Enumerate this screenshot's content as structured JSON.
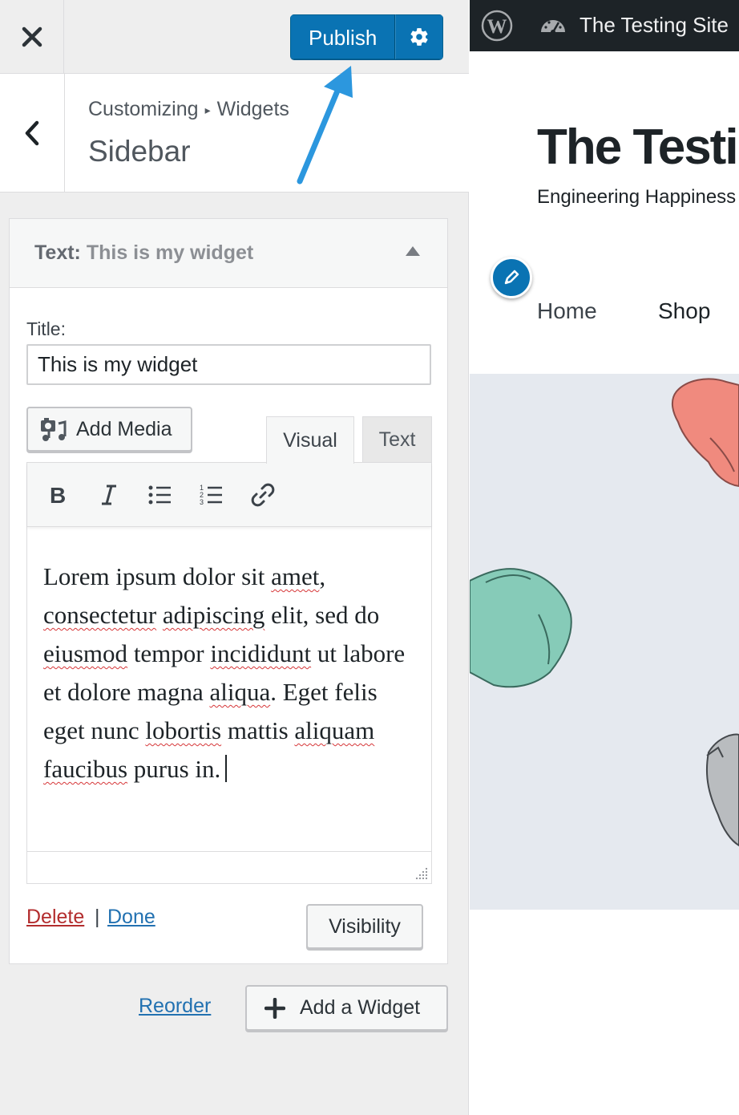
{
  "customizer": {
    "publish_label": "Publish",
    "breadcrumb_root": "Customizing",
    "breadcrumb_sep": "▸",
    "breadcrumb_current": "Widgets",
    "section_title": "Sidebar"
  },
  "widget": {
    "header_type": "Text:",
    "header_name": "This is my widget",
    "title_label": "Title:",
    "title_value": "This is my widget",
    "add_media_label": "Add Media",
    "tab_visual": "Visual",
    "tab_text": "Text",
    "content_parts": [
      "Lorem ipsum dolor sit ",
      "amet",
      ", ",
      "consectetur",
      " ",
      "adipiscing",
      " elit, sed do ",
      "eiusmod",
      " tempor ",
      "incididunt",
      " ut labore et dolore magna ",
      "aliqua",
      ". Eget felis eget nunc ",
      "lobortis",
      " mattis ",
      "aliquam",
      " ",
      "faucibus",
      " purus in."
    ],
    "delete_label": "Delete",
    "separator": "|",
    "done_label": "Done",
    "visibility_label": "Visibility"
  },
  "footer_actions": {
    "reorder_label": "Reorder",
    "add_widget_label": "Add a Widget"
  },
  "preview": {
    "adminbar_site": "The Testing Site",
    "site_title": "The Testing Site",
    "tagline": "Engineering Happiness",
    "nav": [
      "Home",
      "Shop"
    ]
  },
  "colors": {
    "publish_blue": "#0a73b3",
    "link_blue": "#2271b1",
    "delete_red": "#b32d2e",
    "annotation_arrow": "#2c97de",
    "adminbar": "#1d2327",
    "hero_bg": "#e5e9ef"
  },
  "icons": {
    "close": "close-icon",
    "settings": "gear-icon",
    "back": "chevron-left-icon",
    "bold": "bold-icon",
    "italic": "italic-icon",
    "bullist": "bulleted-list-icon",
    "numlist": "numbered-list-icon",
    "link": "link-icon",
    "media": "media-icon",
    "add": "plus-icon",
    "edit": "pencil-icon",
    "wordpress": "wordpress-logo-icon",
    "dashboard": "dashboard-icon"
  }
}
